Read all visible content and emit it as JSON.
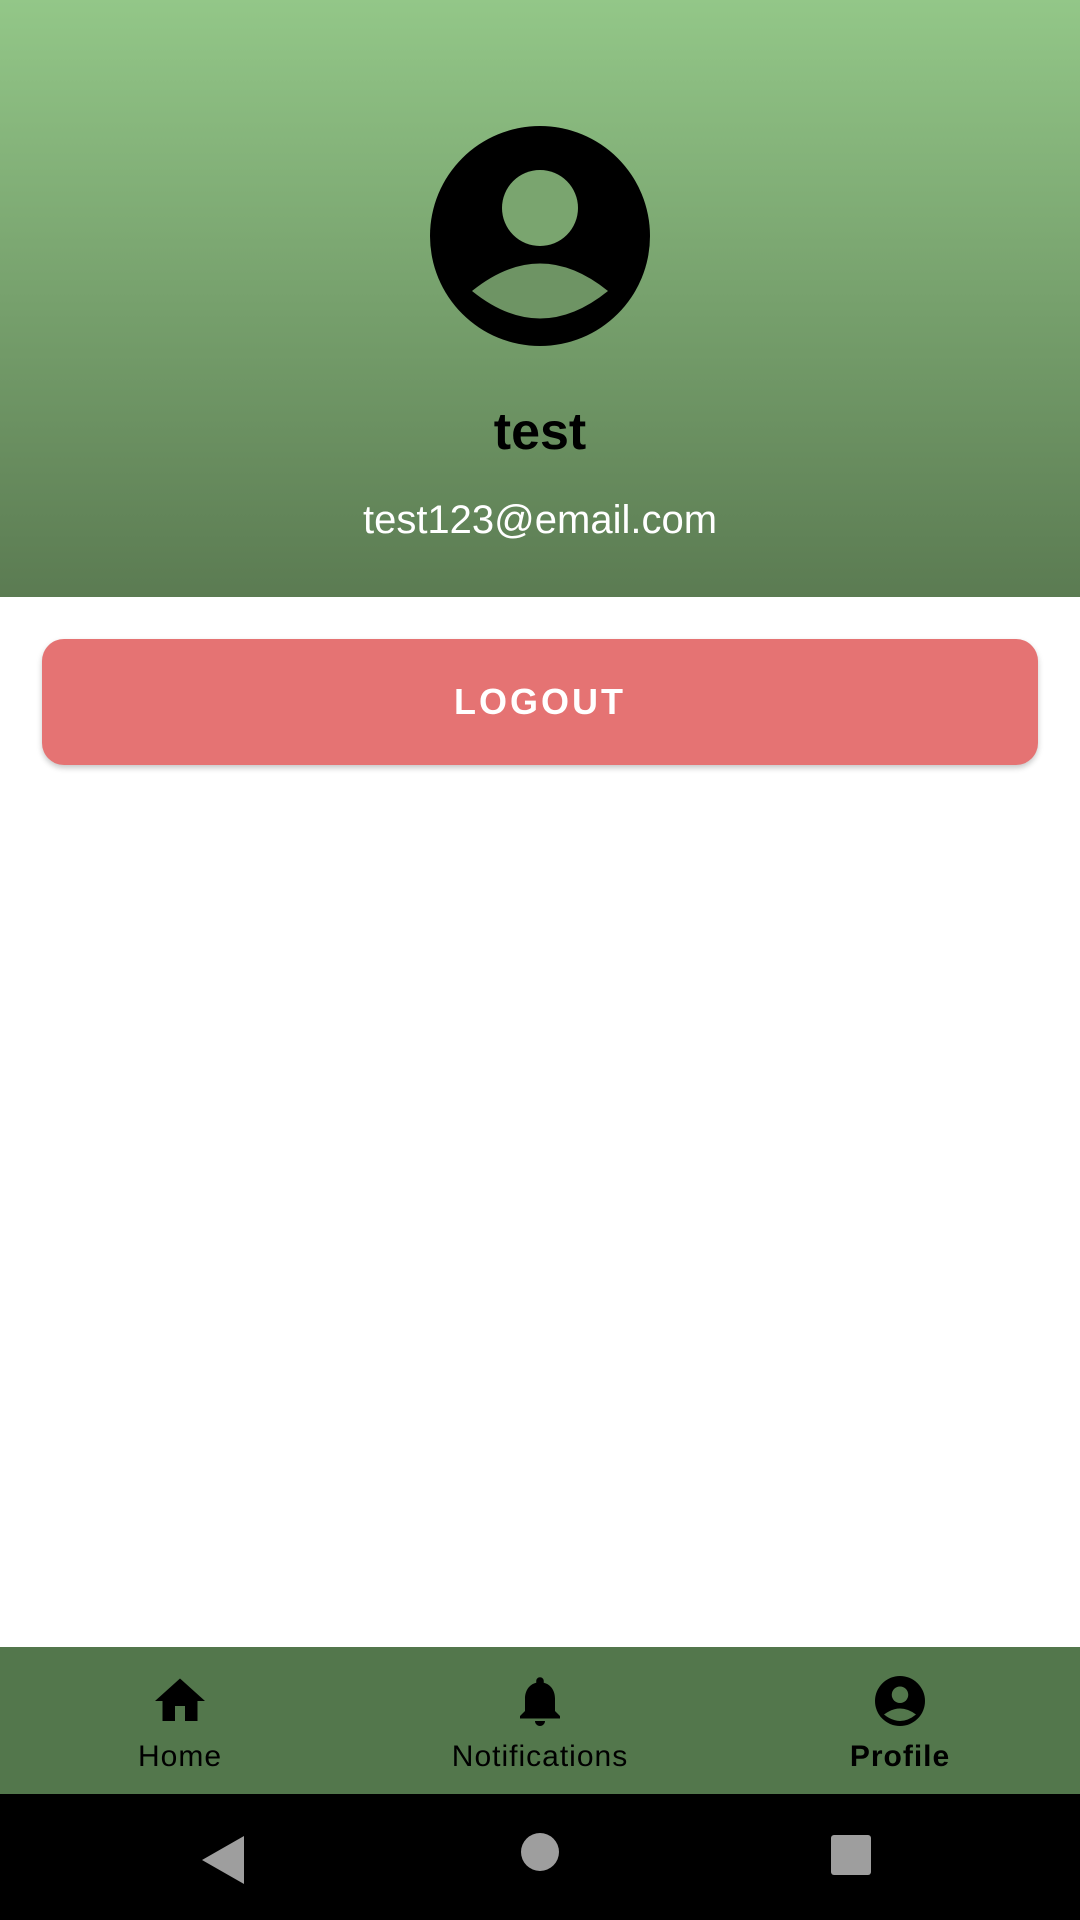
{
  "profile": {
    "name": "test",
    "email": "test123@email.com"
  },
  "actions": {
    "logout_label": "LOGOUT"
  },
  "bottom_nav": {
    "items": [
      {
        "label": "Home",
        "icon": "home-icon",
        "active": false
      },
      {
        "label": "Notifications",
        "icon": "bell-icon",
        "active": false
      },
      {
        "label": "Profile",
        "icon": "account-circle-icon",
        "active": true
      }
    ]
  },
  "system_nav": {
    "buttons": [
      "back-icon",
      "home-circle-icon",
      "recents-square-icon"
    ]
  },
  "colors": {
    "header_gradient_top": "#93c788",
    "header_gradient_bottom": "#5b7b52",
    "logout_button": "#e57373",
    "bottom_nav_bg": "#53774c",
    "system_nav_bg": "#000000",
    "system_icons": "#9e9e9e"
  }
}
